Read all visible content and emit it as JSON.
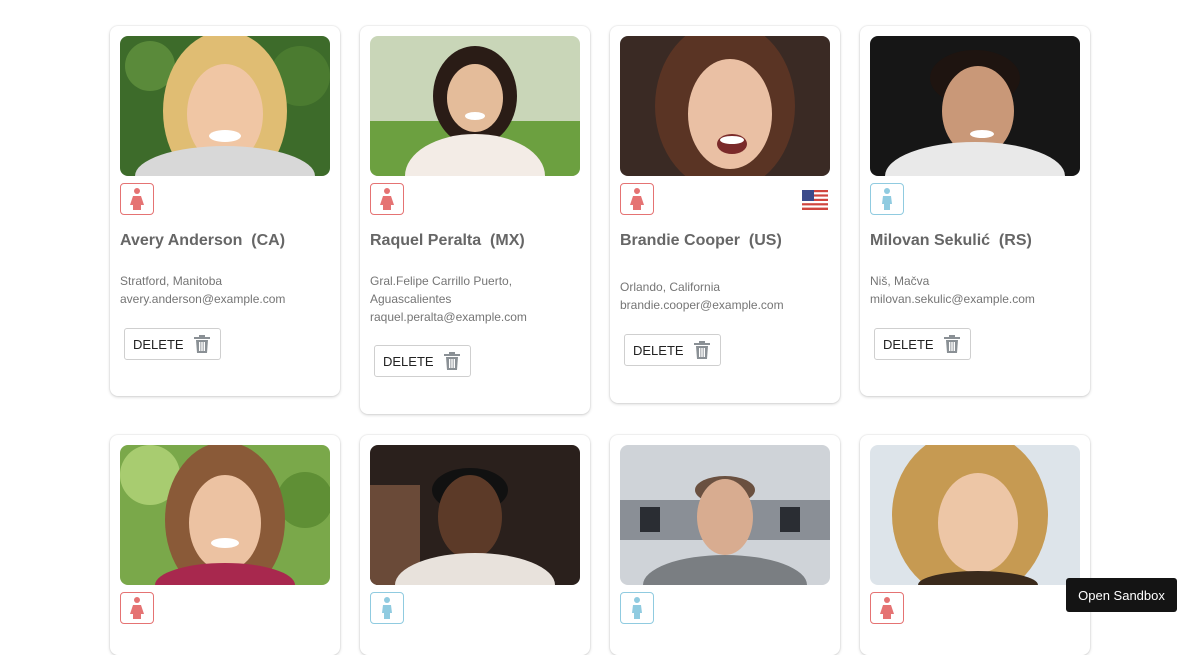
{
  "users": [
    {
      "name": "Avery Anderson  (CA)",
      "lines": [
        "Stratford, Manitoba",
        "avery.anderson@example.com"
      ],
      "gender": "female",
      "delete_label": "DELETE"
    },
    {
      "name": "Raquel Peralta  (MX)",
      "lines": [
        "Gral.Felipe Carrillo Puerto,",
        "Aguascalientes",
        "raquel.peralta@example.com"
      ],
      "gender": "female",
      "delete_label": "DELETE"
    },
    {
      "name": "Brandie Cooper  (US)",
      "lines": [
        "Orlando, California",
        "brandie.cooper@example.com"
      ],
      "gender": "female",
      "flag": "us-flag-icon",
      "delete_label": "DELETE"
    },
    {
      "name": "Milovan Sekulić  (RS)",
      "lines": [
        "Niš, Mačva",
        "milovan.sekulic@example.com"
      ],
      "gender": "male",
      "delete_label": "DELETE"
    },
    {
      "gender": "female"
    },
    {
      "gender": "male"
    },
    {
      "gender": "male"
    },
    {
      "gender": "female"
    }
  ],
  "open_sandbox_label": "Open Sandbox",
  "colors": {
    "female": "#e57373",
    "male": "#90cbe0",
    "card_shadow": "#cccccc",
    "sandbox_bg": "#141414"
  }
}
